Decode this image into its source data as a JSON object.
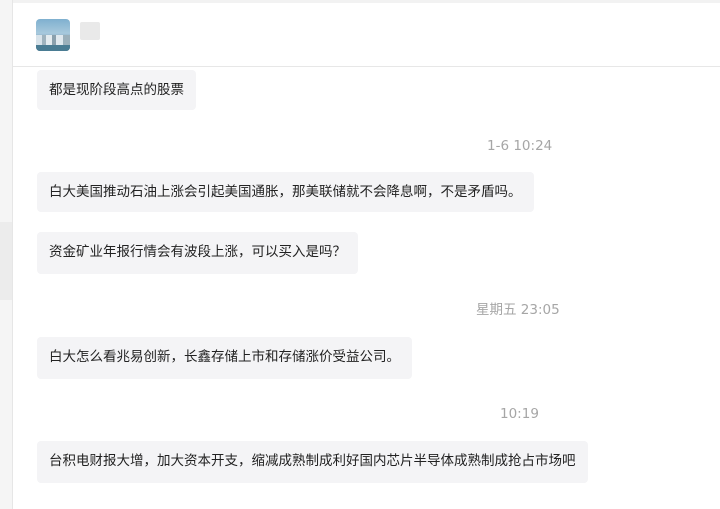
{
  "header": {
    "contact_name": "",
    "avatar_icon": "contact-avatar-photo"
  },
  "messages": [
    {
      "type": "text",
      "text": "都是现阶段高点的股票"
    },
    {
      "type": "timestamp",
      "text": "1-6 10:24"
    },
    {
      "type": "text",
      "text": "白大美国推动石油上涨会引起美国通胀，那美联储就不会降息啊，不是矛盾吗。"
    },
    {
      "type": "text",
      "text": "资金矿业年报行情会有波段上涨，可以买入是吗？"
    },
    {
      "type": "timestamp",
      "text": "星期五 23:05"
    },
    {
      "type": "text",
      "text": "白大怎么看兆易创新，长鑫存储上市和存储涨价受益公司。"
    },
    {
      "type": "timestamp",
      "text": "10:19"
    },
    {
      "type": "text",
      "text": "台积电财报大增，加大资本开支，缩减成熟制成利好国内芯片半导体成熟制成抢占市场吧"
    }
  ]
}
